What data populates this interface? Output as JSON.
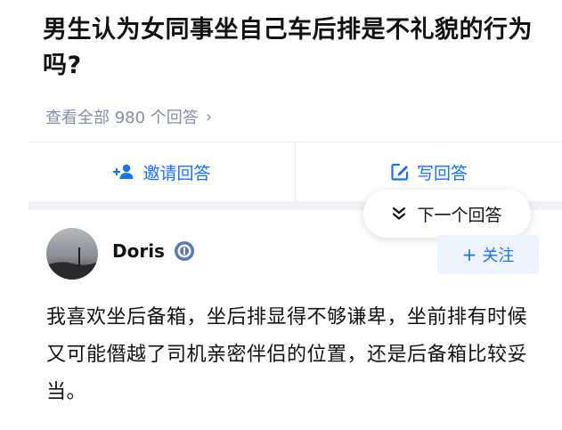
{
  "question": {
    "title": "男生认为女同事坐自己车后排是不礼貌的行为吗?",
    "view_all": "查看全部 980 个回答",
    "view_all_chevron_icon": "chevron-right-icon"
  },
  "actions": {
    "invite_label": "邀请回答",
    "invite_icon": "add-user-icon",
    "write_label": "写回答",
    "write_icon": "edit-icon",
    "accent": "#1772f6"
  },
  "next_answer": {
    "label": "下一个回答",
    "icon": "double-chevron-down-icon"
  },
  "answer": {
    "author": "Doris",
    "badge_icon": "badge-icon",
    "follow_label": "关注",
    "follow_icon": "plus-icon",
    "body": "我喜欢坐后备箱，坐后排显得不够谦卑，坐前排有时候又可能僭越了司机亲密伴侣的位置，还是后备箱比较妥当。"
  }
}
